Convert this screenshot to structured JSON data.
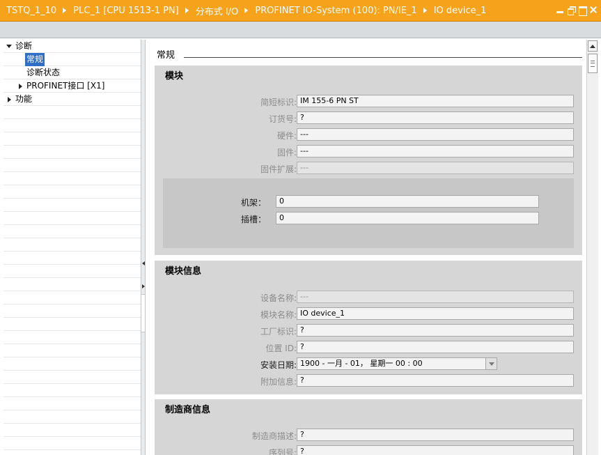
{
  "breadcrumb": [
    "TSTQ_1_10",
    "PLC_1 [CPU 1513-1 PN]",
    "分布式 I/O",
    "PROFINET IO-System (100): PN/IE_1",
    "IO device_1"
  ],
  "colors": {
    "title_bar": "#f7a21b",
    "selection": "#2f6fc5",
    "section_bg": "#d6d6d6"
  },
  "tree": {
    "diagnostics": "诊断",
    "general": "常规",
    "diag_status": "诊断状态",
    "profinet_interface": "PROFINET接口 [X1]",
    "functions": "功能"
  },
  "main": {
    "heading": "常规",
    "module": {
      "title": "模块",
      "short_designation_label": "简短标识:",
      "short_designation": "IM 155-6 PN ST",
      "order_number_label": "订货号:",
      "order_number": "?",
      "hardware_label": "硬件:",
      "hardware": "---",
      "firmware_label": "固件:",
      "firmware": "---",
      "firmware_ext_label": "固件扩展:",
      "firmware_ext": "---",
      "rack_label": "机架：",
      "rack": "0",
      "slot_label": "插槽：",
      "slot": "0"
    },
    "module_info": {
      "title": "模块信息",
      "device_name_label": "设备名称:",
      "device_name": "---",
      "module_name_label": "模块名称:",
      "module_name": "IO device_1",
      "plant_id_label": "工厂标识:",
      "plant_id": "?",
      "location_id_label": "位置 ID:",
      "location_id": "?",
      "install_date_label": "安装日期:",
      "install_date": "1900 - 一月  - 01， 星期一    00 : 00",
      "additional_info_label": "附加信息:",
      "additional_info": "?"
    },
    "manufacturer_info": {
      "title": "制造商信息",
      "manufacturer_desc_label": "制造商描述:",
      "manufacturer_desc": "?",
      "serial_number_label": "序列号:",
      "serial_number": "?"
    }
  }
}
